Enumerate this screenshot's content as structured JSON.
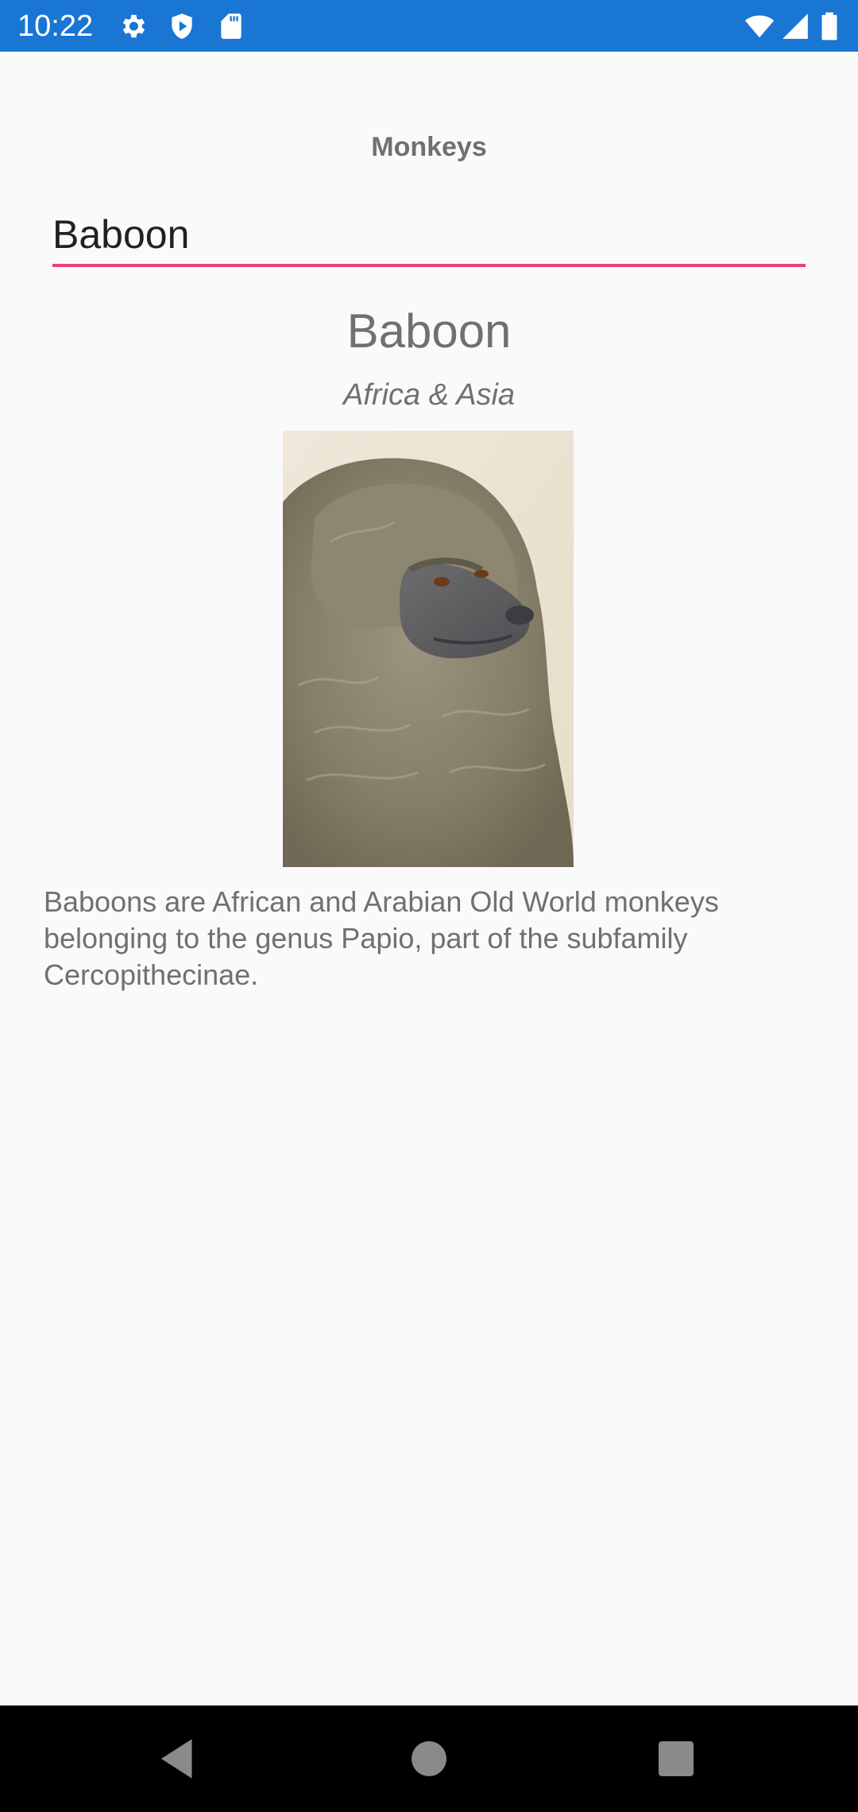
{
  "status_bar": {
    "time": "10:22",
    "color": "#1976d2",
    "left_icons": [
      "gear-icon",
      "shield-play-icon",
      "sd-card-icon"
    ],
    "right_icons": [
      "wifi-icon",
      "cell-signal-icon",
      "battery-icon"
    ]
  },
  "page": {
    "title": "Monkeys"
  },
  "search": {
    "value": "Baboon",
    "underline_color": "#ec407a"
  },
  "monkey": {
    "name": "Baboon",
    "location": "Africa & Asia",
    "image": "baboon-photo",
    "details": "Baboons are African and Arabian Old World monkeys belonging to the genus Papio, part of the subfamily Cercopithecinae."
  },
  "nav_bar": {
    "buttons": [
      "back-icon",
      "home-icon",
      "recents-icon"
    ]
  }
}
